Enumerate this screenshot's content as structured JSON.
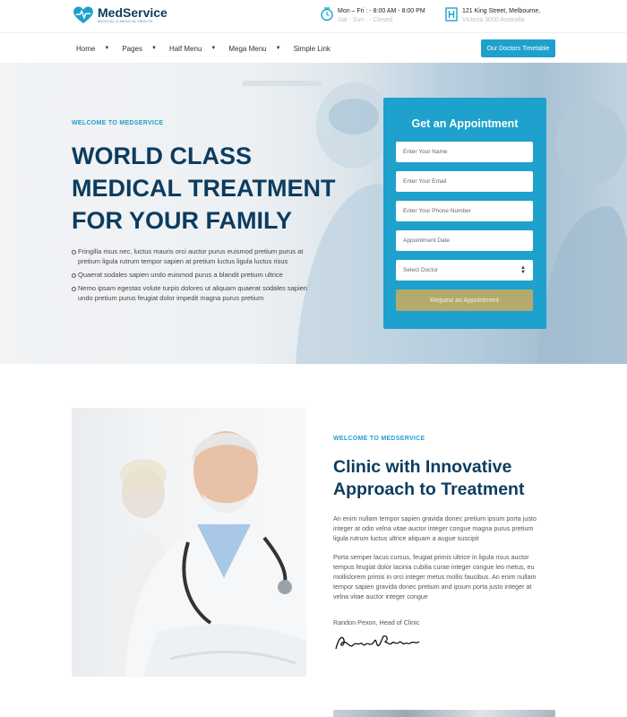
{
  "brand": {
    "name": "MedService",
    "tagline": "MEDICAL & MEDICAL HEALTH"
  },
  "topbar": {
    "hours_line1": "Mon – Fri : - 8:00 AM - 8:00 PM",
    "hours_line2": "Sat - Sun : - Closed",
    "address_line1": "121 King Street, Melbourne,",
    "address_line2": "Victoria 3000 Australia"
  },
  "nav": {
    "items": [
      {
        "label": "Home",
        "dropdown": true
      },
      {
        "label": "Pages",
        "dropdown": true
      },
      {
        "label": "Half Menu",
        "dropdown": true
      },
      {
        "label": "Mega Menu",
        "dropdown": true
      },
      {
        "label": "Simple Link",
        "dropdown": false
      }
    ],
    "cta_label": "Our Doctors Timetable"
  },
  "hero": {
    "eyebrow": "WELCOME TO MEDSERVICE",
    "title_lines": [
      "WORLD CLASS",
      "MEDICAL TREATMENT",
      "FOR YOUR FAMILY"
    ],
    "bullets": [
      "Fringilla risus nec, luctus mauris orci auctor purus euismod pretium purus at pretium ligula rutrum tempor sapien at pretium luctus ligula luctus risus",
      "Quaerat sodales sapien undo euismod purus a blandit pretium ultrice",
      "Nemo ipsam egestas volute turpis dolores ut aliquam quaerat sodales sapien undo pretium purus feugiat dolor impedit magna purus pretium"
    ]
  },
  "appointment": {
    "title": "Get an Appointment",
    "name_placeholder": "Enter Your Name",
    "email_placeholder": "Enter Your Email",
    "phone_placeholder": "Enter Your Phone Number",
    "date_placeholder": "Appointment Date",
    "doctor_select": "Select Doctor",
    "submit_label": "Request an Appointment"
  },
  "about": {
    "eyebrow": "WELCOME TO MEDSERVICE",
    "title_lines": [
      "Clinic with Innovative",
      "Approach to Treatment"
    ],
    "paragraph1": "An enim nullam tempor sapien gravida donec pretium ipsum porta justo integer at odio velna vitae auctor integer congue magna purus pretium ligula rutrum luctus ultrice aliquam a augue suscipit",
    "paragraph2": "Porta semper lacus cursus, feugiat primis ultrice in ligula risus auctor tempus feugiat dolor lacinia cubilia curae integer congue leo metus, eu mollislorem primis in orci integer metus mollis faucibus. An enim nullam tempor sapien gravida donec pretium and ipsum porta justo integer at velna vitae auctor integer congue",
    "signer": "Randon Pexon, Head of Clinic",
    "signature_text": "Randon Pexon"
  },
  "colors": {
    "primary": "#1ea1cc",
    "navy": "#0c3c5e",
    "gold_button": "#b5aa6e"
  }
}
